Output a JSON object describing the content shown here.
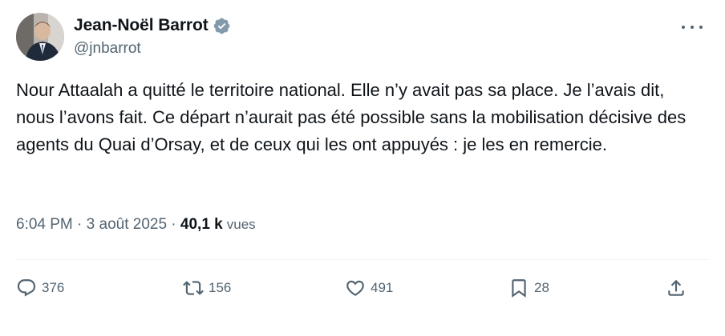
{
  "author": {
    "name": "Jean-Noël Barrot",
    "handle": "@jnbarrot",
    "verified": true
  },
  "tweet": {
    "text": "Nour Attaalah a quitté le territoire national. Elle n’y avait pas sa place. Je l’avais dit, nous l’avons fait. Ce départ n’aurait pas été possible sans la mobilisation décisive des agents du Quai d’Orsay, et de ceux qui les ont appuyés : je les en remercie."
  },
  "meta": {
    "time": "6:04 PM",
    "separator": " · ",
    "date": "3 août 2025",
    "views_count": "40,1 k",
    "views_label": "vues"
  },
  "actions": {
    "replies": "376",
    "retweets": "156",
    "likes": "491",
    "bookmarks": "28"
  },
  "icons": {
    "reply": "reply-icon",
    "retweet": "retweet-icon",
    "like": "heart-icon",
    "bookmark": "bookmark-icon",
    "share": "share-icon",
    "more": "more-icon",
    "verified": "verified-badge-icon"
  },
  "colors": {
    "text": "#0f1419",
    "secondary": "#536471",
    "verified": "#829aab",
    "divider": "#eff3f4"
  }
}
